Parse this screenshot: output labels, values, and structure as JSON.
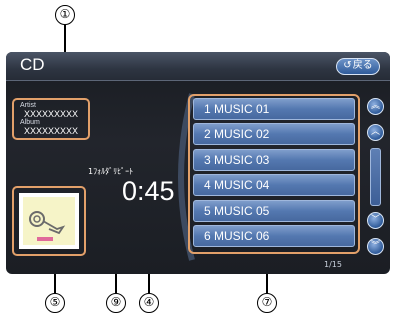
{
  "callouts": {
    "c1": "①",
    "c5": "⑤",
    "c9": "⑨",
    "c4": "④",
    "c7": "⑦"
  },
  "header": {
    "title": "CD",
    "back_label": "戻る",
    "back_icon": "return-arrow-icon"
  },
  "info": {
    "artist_label": "Artist",
    "artist_value": "XXXXXXXXX",
    "album_label": "Album",
    "album_value": "XXXXXXXXX"
  },
  "player": {
    "repeat_mode": "1ﾌｫﾙﾀﾞﾘﾋﾟｰﾄ",
    "time": "0:45"
  },
  "tracks": [
    "1 MUSIC 01",
    "2 MUSIC 02",
    "3 MUSIC 03",
    "4 MUSIC 04",
    "5 MUSIC 05",
    "6 MUSIC 06"
  ],
  "page_indicator": "1/15",
  "colors": {
    "highlight_border": "#e2a06a",
    "track_bg": "#5478b0",
    "button_blue": "#2f5b9a"
  }
}
